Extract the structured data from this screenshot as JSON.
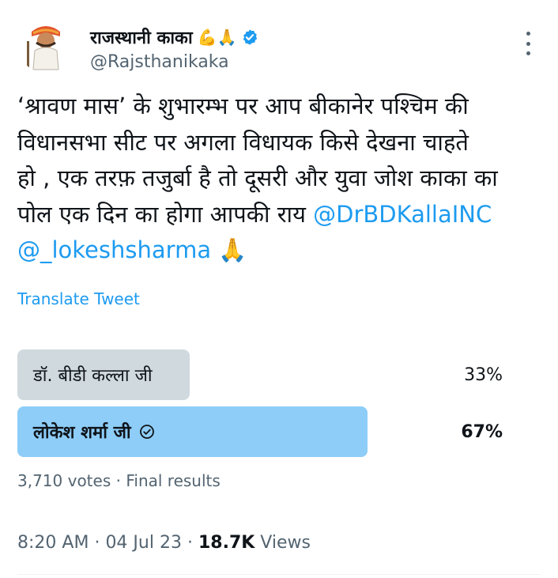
{
  "author": {
    "display_name": "राजस्थानी काका",
    "name_emoji": "💪🙏",
    "handle": "@Rajsthanikaka",
    "verified": true
  },
  "tweet": {
    "lines": [
      "‘श्रावण मास’ के शुभारम्भ पर आप बीकानेर पश्चिम की",
      "विधानसभा सीट पर अगला विधायक किसे देखना चाहते",
      "हो , एक तरफ़ तजुर्बा है तो दूसरी और युवा जोश काका का",
      "पोल एक दिन का होगा आपकी राय "
    ],
    "mention_1": "@DrBDKallaINC",
    "mention_2": "@_lokeshsharma",
    "trailing_emoji": "🙏",
    "translate_label": "Translate Tweet"
  },
  "poll": {
    "options": [
      {
        "label": "डॉ. बीडी कल्ला जी",
        "percent": "33%",
        "fraction": 0.33,
        "winner": false
      },
      {
        "label": "लोकेश शर्मा जी",
        "percent": "67%",
        "fraction": 0.67,
        "winner": true
      }
    ],
    "votes": "3,710 votes",
    "separator": "·",
    "status": "Final results"
  },
  "meta": {
    "time": "8:20 AM",
    "date": "04 Jul 23",
    "separator": "·",
    "views_count": "18.7K",
    "views_label": "Views"
  },
  "colors": {
    "accent": "#1d9bf0",
    "loser_bar": "#cfd9de",
    "winner_bar": "#8ecdf8",
    "secondary_text": "#536471"
  },
  "icons": {
    "verified": "verified-badge-icon",
    "more": "more-options-icon",
    "winner": "check-circle-icon"
  }
}
